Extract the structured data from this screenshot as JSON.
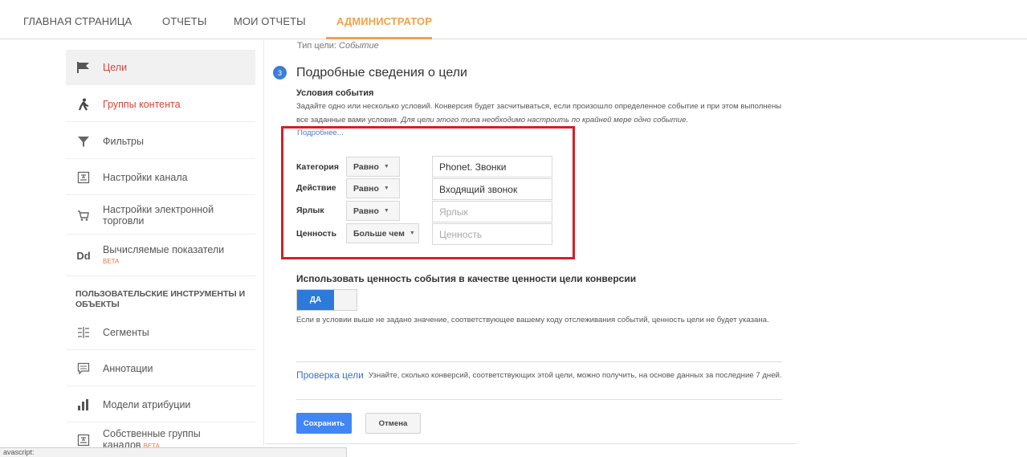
{
  "nav": {
    "tabs": [
      "ГЛАВНАЯ СТРАНИЦА",
      "ОТЧЕТЫ",
      "МОИ ОТЧЕТЫ",
      "АДМИНИСТРАТОР"
    ],
    "active": "АДМИНИСТРАТОР"
  },
  "sidebar": {
    "items": [
      {
        "label": "Цели",
        "icon": "flag-icon"
      },
      {
        "label": "Группы контента",
        "icon": "person-walking-icon"
      },
      {
        "label": "Фильтры",
        "icon": "filter-icon"
      },
      {
        "label": "Настройки канала",
        "icon": "channel-settings-icon"
      },
      {
        "label": "Настройки электронной торговли",
        "icon": "cart-icon"
      },
      {
        "label": "Вычисляемые показатели",
        "icon": "dd-icon",
        "badge": "BETA"
      },
      {
        "label": "Сегменты",
        "icon": "segments-icon"
      },
      {
        "label": "Аннотации",
        "icon": "annotation-icon"
      },
      {
        "label": "Модели атрибуции",
        "icon": "bar-chart-icon"
      },
      {
        "label": "Собственные группы каналов",
        "icon": "custom-channel-icon",
        "badge": "BETA"
      }
    ],
    "section_title": "ПОЛЬЗОВАТЕЛЬСКИЕ ИНСТРУМЕНТЫ И ОБЪЕКТЫ"
  },
  "goal": {
    "type_label": "Тип цели:",
    "type_value": "Событие",
    "step_number": "3",
    "heading": "Подробные сведения о цели",
    "conditions_heading": "Условия события",
    "description": "Задайте одно или несколько условий. Конверсия будет засчитываться, если произошло определенное событие и при этом выполнены все заданные вами условия.",
    "description_italic": "Для цели этого типа необходимо настроить по крайней мере одно событие.",
    "more_link": "Подробнее...",
    "conditions": [
      {
        "label": "Категория",
        "operator": "Равно",
        "value": "Phonet. Звонки",
        "placeholder": ""
      },
      {
        "label": "Действие",
        "operator": "Равно",
        "value": "Входящий звонок",
        "placeholder": ""
      },
      {
        "label": "Ярлык",
        "operator": "Равно",
        "value": "",
        "placeholder": "Ярлык"
      },
      {
        "label": "Ценность",
        "operator": "Больше чем",
        "value": "",
        "placeholder": "Ценность"
      }
    ],
    "use_value_heading": "Использовать ценность события в качестве ценности цели конверсии",
    "toggle_label": "ДА",
    "toggle_note": "Если в условии выше не задано значение, соответствующее вашему коду отслеживания событий, ценность цели не будет указана.",
    "verify_link": "Проверка цели",
    "verify_text": "Узнайте, сколько конверсий, соответствующих этой цели, можно получить, на основе данных за последние 7 дней.",
    "save_label": "Сохранить",
    "cancel_label": "Отмена"
  },
  "statusbar": {
    "text": "avascript:"
  },
  "colors": {
    "accent": "#f2a14a",
    "highlight_box": "#d32027",
    "primary_button": "#4285f4",
    "link": "#3a72c4"
  }
}
